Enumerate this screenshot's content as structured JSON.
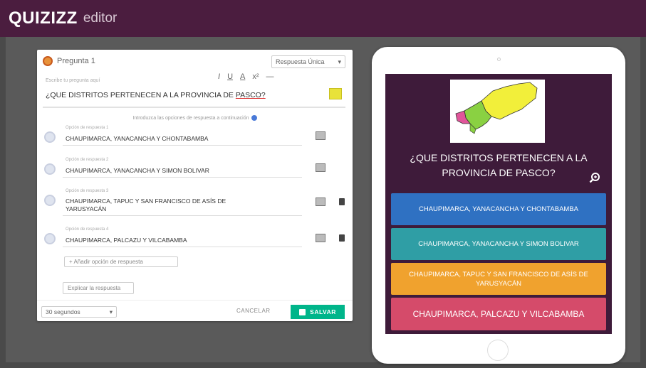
{
  "app": {
    "logo": "QUIZIZZ",
    "subtitle": "editor",
    "accent": "#4b1d3f"
  },
  "editor": {
    "question_label": "Pregunta 1",
    "answer_type": "Respuesta Única",
    "question_hint": "Escribe tu pregunta aquí",
    "format_bar": [
      "I",
      "U",
      "A",
      "x²",
      "—"
    ],
    "question_text_before": "¿QUE DISTRITOS PERTENECEN A LA PROVINCIA DE ",
    "question_text_underlined": "PASCO?",
    "options_hint": "Introduzca las opciones de respuesta a continuación",
    "options": [
      {
        "hint": "Opción de respuesta 1",
        "text": "CHAUPIMARCA, YANACANCHA Y CHONTABAMBA"
      },
      {
        "hint": "Opción de respuesta 2",
        "text": "CHAUPIMARCA, YANACANCHA Y SIMON BOLIVAR"
      },
      {
        "hint": "Opción de respuesta 3",
        "text": "CHAUPIMARCA, TAPUC Y SAN FRANCISCO DE ASÍS DE YARUSYACÁN"
      },
      {
        "hint": "Opción de respuesta 4",
        "text": "CHAUPIMARCA, PALCAZU Y VILCABAMBA"
      }
    ],
    "add_option": "+ Añadir opción de respuesta",
    "explain": "Explicar la respuesta",
    "timer": "30 segundos",
    "cancel": "CANCELAR",
    "save": "SALVAR"
  },
  "preview": {
    "question": "¿QUE DISTRITOS PERTENECEN A LA PROVINCIA DE PASCO?",
    "answers": [
      {
        "text": "CHAUPIMARCA, YANACANCHA Y CHONTABAMBA",
        "color": "#2f71c2"
      },
      {
        "text": "CHAUPIMARCA, YANACANCHA Y SIMON BOLIVAR",
        "color": "#2f9ea5"
      },
      {
        "text": "CHAUPIMARCA, TAPUC Y SAN FRANCISCO DE ASÍS DE YARUSYACÁN",
        "color": "#f0a22e"
      },
      {
        "text": "CHAUPIMARCA, PALCAZU Y VILCABAMBA",
        "color": "#d54b6a"
      }
    ]
  }
}
